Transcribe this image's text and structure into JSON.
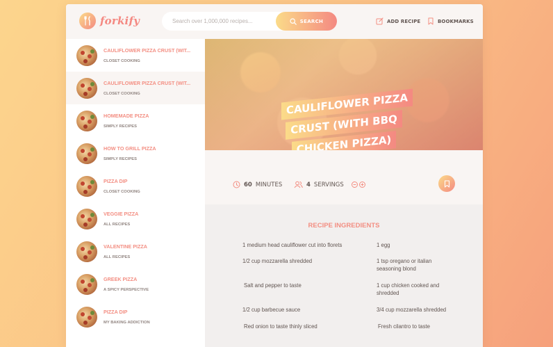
{
  "app": {
    "logo_text": "forkify"
  },
  "search": {
    "placeholder": "Search over 1,000,000 recipes...",
    "button_label": "SEARCH"
  },
  "nav": {
    "add_recipe": "ADD RECIPE",
    "bookmarks": "BOOKMARKS"
  },
  "results": [
    {
      "title": "CAULIFLOWER PIZZA CRUST (WIT...",
      "publisher": "CLOSET COOKING"
    },
    {
      "title": "CAULIFLOWER PIZZA CRUST (WIT...",
      "publisher": "CLOSET COOKING"
    },
    {
      "title": "HOMEMADE PIZZA",
      "publisher": "SIMPLY RECIPES"
    },
    {
      "title": "HOW TO GRILL PIZZA",
      "publisher": "SIMPLY RECIPES"
    },
    {
      "title": "PIZZA DIP",
      "publisher": "CLOSET COOKING"
    },
    {
      "title": "VEGGIE PIZZA",
      "publisher": "ALL RECIPES"
    },
    {
      "title": "VALENTINE PIZZA",
      "publisher": "ALL RECIPES"
    },
    {
      "title": "GREEK PIZZA",
      "publisher": "A SPICY PERSPECTIVE"
    },
    {
      "title": "PIZZA DIP",
      "publisher": "MY BAKING ADDICTION"
    }
  ],
  "recipe": {
    "title_lines": [
      "CAULIFLOWER PIZZA",
      "CRUST (WITH BBQ",
      "CHICKEN PIZZA)"
    ],
    "minutes": "60",
    "minutes_unit": "MINUTES",
    "servings": "4",
    "servings_unit": "SERVINGS",
    "ingredients_title": "RECIPE INGREDIENTS",
    "ingredients": [
      "1 medium head cauliflower cut into florets",
      "1 egg",
      "1/2 cup mozzarella shredded",
      "1 tsp oregano or italian seasoning blond",
      "Salt and pepper to taste",
      "1 cup chicken cooked and shredded",
      "1/2 cup barbecue sauce",
      "3/4 cup mozzarella shredded",
      "Red onion to taste thinly sliced",
      "Fresh cilantro to taste"
    ]
  },
  "colors": {
    "accent_start": "#fbdb89",
    "accent_end": "#f48982",
    "text": "#615551",
    "bg_light": "#f9f5f3"
  }
}
